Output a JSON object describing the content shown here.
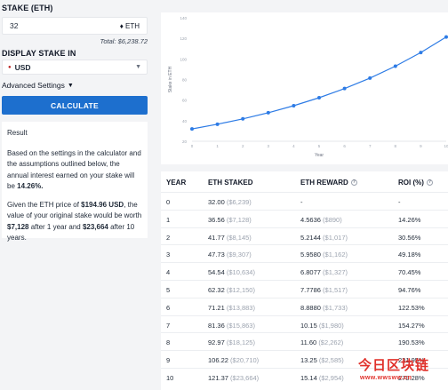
{
  "stake": {
    "label": "STAKE (ETH)",
    "value": "32",
    "unit": "♦ ETH",
    "total": "Total: $6,238.72"
  },
  "display": {
    "label": "DISPLAY STAKE IN",
    "currency": "USD"
  },
  "advanced": {
    "label": "Advanced Settings"
  },
  "calculate": {
    "label": "CALCULATE"
  },
  "result": {
    "title": "Result",
    "p1_text": "Based on the settings in the calculator and the assumptions outlined below, the annual interest earned on your stake will be ",
    "p1_rate": "14.26%.",
    "p2_a": "Given the ETH price of ",
    "p2_price": "$194.96 USD",
    "p2_b": ", the value of your original stake would be worth ",
    "p2_v1": "$7,128",
    "p2_c": " after 1 year and ",
    "p2_v10": "$23,664",
    "p2_d": " after 10 years."
  },
  "table": {
    "headers": [
      "YEAR",
      "ETH STAKED",
      "ETH REWARD",
      "ROI (%)"
    ],
    "rows": [
      {
        "year": "0",
        "staked": "32.00",
        "staked_usd": "($6,239)",
        "reward": "-",
        "reward_usd": "",
        "roi": "-"
      },
      {
        "year": "1",
        "staked": "36.56",
        "staked_usd": "($7,128)",
        "reward": "4.5636",
        "reward_usd": "($890)",
        "roi": "14.26%"
      },
      {
        "year": "2",
        "staked": "41.77",
        "staked_usd": "($8,145)",
        "reward": "5.2144",
        "reward_usd": "($1,017)",
        "roi": "30.56%"
      },
      {
        "year": "3",
        "staked": "47.73",
        "staked_usd": "($9,307)",
        "reward": "5.9580",
        "reward_usd": "($1,162)",
        "roi": "49.18%"
      },
      {
        "year": "4",
        "staked": "54.54",
        "staked_usd": "($10,634)",
        "reward": "6.8077",
        "reward_usd": "($1,327)",
        "roi": "70.45%"
      },
      {
        "year": "5",
        "staked": "62.32",
        "staked_usd": "($12,150)",
        "reward": "7.7786",
        "reward_usd": "($1,517)",
        "roi": "94.76%"
      },
      {
        "year": "6",
        "staked": "71.21",
        "staked_usd": "($13,883)",
        "reward": "8.8880",
        "reward_usd": "($1,733)",
        "roi": "122.53%"
      },
      {
        "year": "7",
        "staked": "81.36",
        "staked_usd": "($15,863)",
        "reward": "10.15",
        "reward_usd": "($1,980)",
        "roi": "154.27%"
      },
      {
        "year": "8",
        "staked": "92.97",
        "staked_usd": "($18,125)",
        "reward": "11.60",
        "reward_usd": "($2,262)",
        "roi": "190.53%"
      },
      {
        "year": "9",
        "staked": "106.22",
        "staked_usd": "($20,710)",
        "reward": "13.25",
        "reward_usd": "($2,585)",
        "roi": "231.95%"
      },
      {
        "year": "10",
        "staked": "121.37",
        "staked_usd": "($23,664)",
        "reward": "15.14",
        "reward_usd": "($2,954)",
        "roi": "279.28%"
      }
    ]
  },
  "watermark": {
    "text": "今日区块链",
    "url": "www.wwsww.cn"
  },
  "chart_data": {
    "type": "line",
    "xlabel": "Year",
    "ylabel": "Stake in ETH",
    "x": [
      0,
      1,
      2,
      3,
      4,
      5,
      6,
      7,
      8,
      9,
      10
    ],
    "series": [
      {
        "values": [
          32.0,
          36.56,
          41.77,
          47.73,
          54.54,
          62.32,
          71.21,
          81.36,
          92.97,
          106.22,
          121.37
        ]
      }
    ],
    "xticks": [
      "0",
      "1",
      "2",
      "3",
      "4",
      "5",
      "6",
      "7",
      "8",
      "9",
      "10"
    ],
    "yticks": [
      "20",
      "40",
      "60",
      "80",
      "100",
      "120",
      "140"
    ],
    "ylim": [
      20,
      140
    ],
    "xlim": [
      0,
      10
    ],
    "grid": false,
    "color": "#2d7be5"
  }
}
